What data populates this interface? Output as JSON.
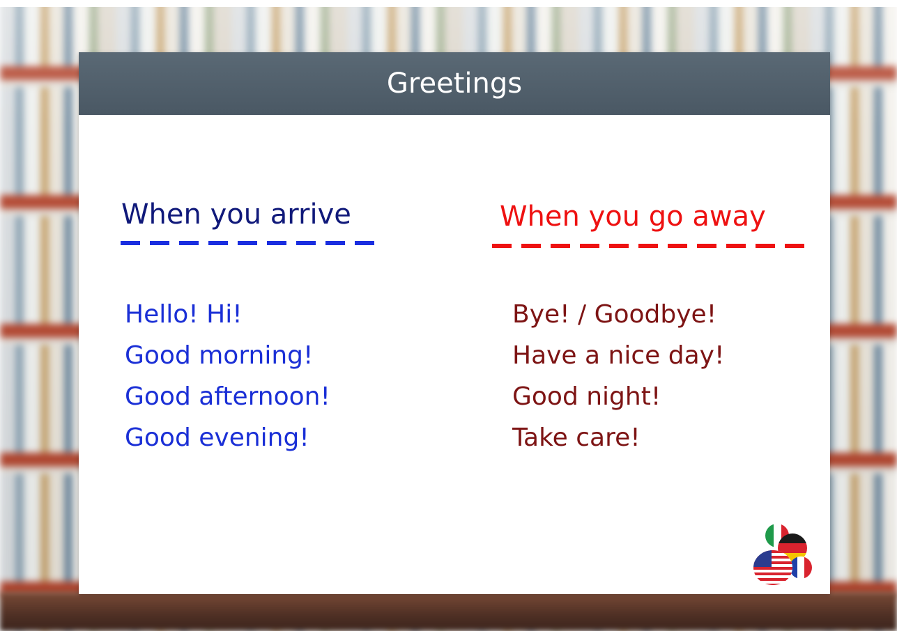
{
  "slide": {
    "title": "Greetings"
  },
  "left_column": {
    "heading": "When you arrive",
    "phrases": [
      "Hello! Hi!",
      "Good morning!",
      "Good afternoon!",
      "Good evening!"
    ]
  },
  "right_column": {
    "heading": "When you go away",
    "phrases": [
      "Bye! / Goodbye!",
      "Have a nice day!",
      "Good night!",
      "Take care!"
    ]
  },
  "colors": {
    "header_bg": "#4f5e6a",
    "left_heading": "#10197a",
    "left_accent": "#1a2ee0",
    "left_text": "#1a2fd6",
    "right_heading": "#ee1111",
    "right_accent": "#ee1111",
    "right_text": "#7d1414"
  },
  "logo": {
    "icon": "language-flags-logo-icon"
  }
}
